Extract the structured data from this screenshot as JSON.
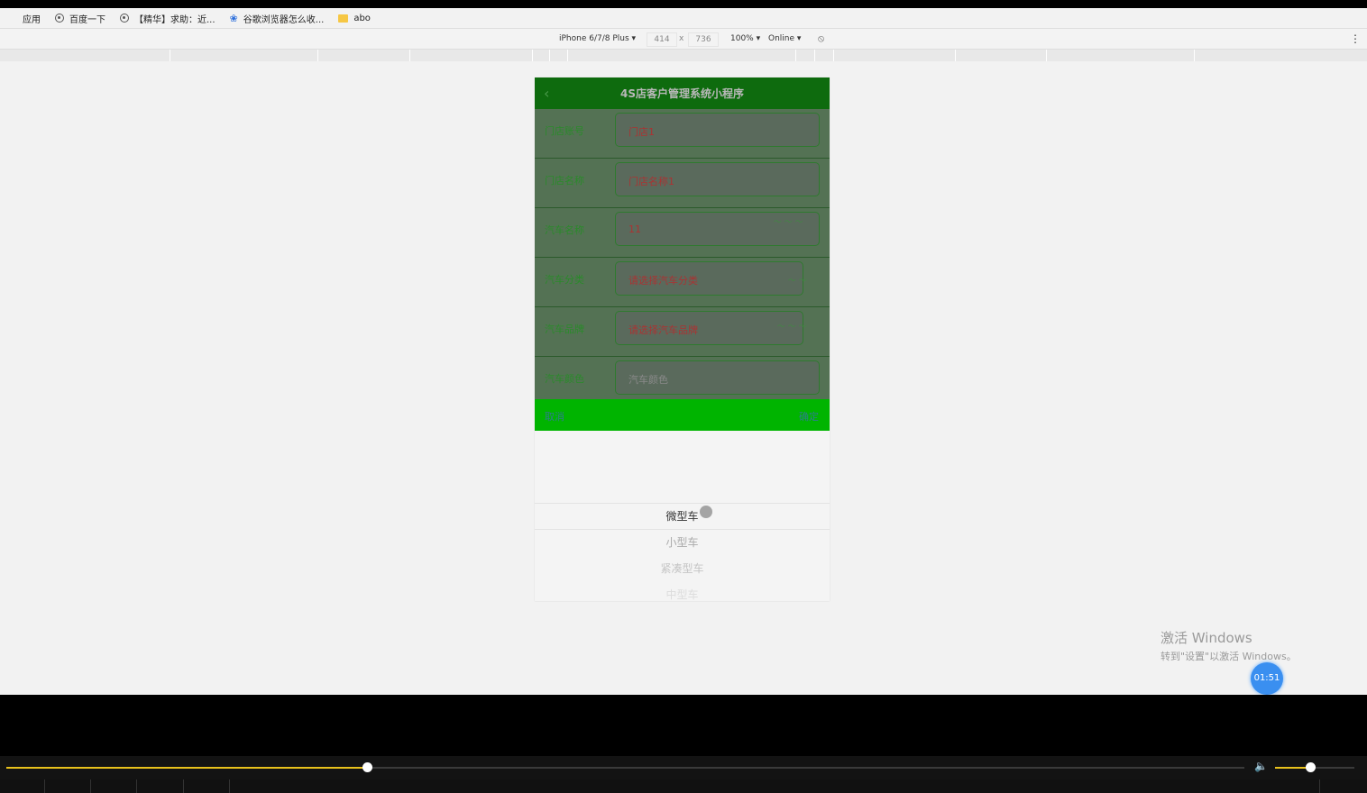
{
  "bookmarks": [
    {
      "label": "应用",
      "icon": "apps-icon"
    },
    {
      "label": "百度一下",
      "icon": "globe-icon"
    },
    {
      "label": "【精华】求助：近...",
      "icon": "globe-icon"
    },
    {
      "label": "谷歌浏览器怎么收...",
      "icon": "paw-icon"
    },
    {
      "label": "abo",
      "icon": "folder-icon"
    }
  ],
  "devtools": {
    "device": "iPhone 6/7/8 Plus ▾",
    "width": "414",
    "times": "x",
    "height": "736",
    "zoom": "100% ▾",
    "network": "Online ▾",
    "more": "⋮"
  },
  "app": {
    "back": "‹",
    "title": "4S店客户管理系统小程序",
    "fields": [
      {
        "label": "门店账号",
        "value": "门店1",
        "style": "red"
      },
      {
        "label": "门店名称",
        "value": "门店名称1",
        "style": "red"
      },
      {
        "label": "汽车名称",
        "value": "11",
        "style": "red"
      },
      {
        "label": "汽车分类",
        "value": "请选择汽车分类",
        "style": "red"
      },
      {
        "label": "汽车品牌",
        "value": "请选择汽车品牌",
        "style": "red"
      },
      {
        "label": "汽车颜色",
        "value": "汽车颜色",
        "style": "gray"
      }
    ],
    "picker": {
      "cancel": "取消",
      "confirm": "确定",
      "options": [
        "微型车",
        "小型车",
        "紧凑型车",
        "中型车"
      ]
    }
  },
  "watermark": {
    "line1": "激活 Windows",
    "line2": "转到\"设置\"以激活 Windows。"
  },
  "timer": "01:51",
  "player": {
    "progress": 0.291,
    "volume": 0.44,
    "accent": "#e8c21c"
  }
}
